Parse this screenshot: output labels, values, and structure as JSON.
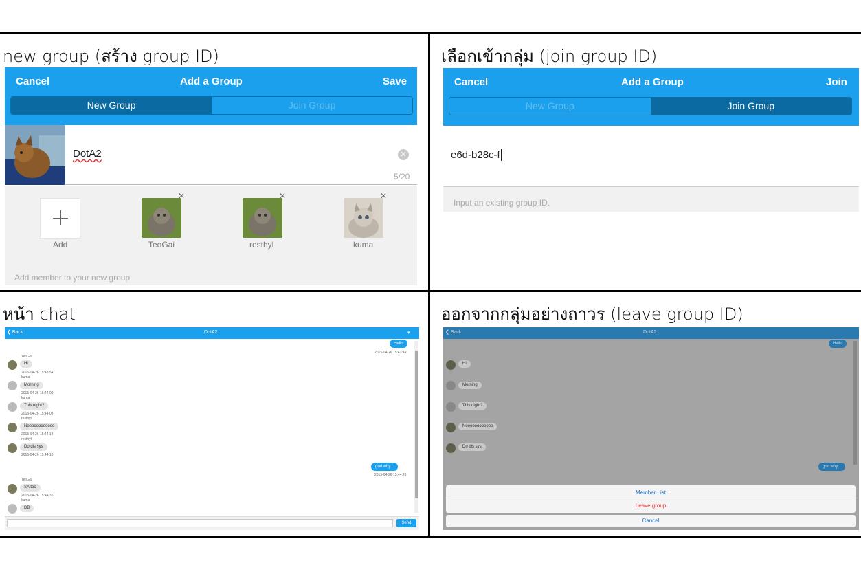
{
  "captions": {
    "new_group": "new group (สร้าง group ID)",
    "join_group": "เลือกเข้ากลุ่ม (join group ID)",
    "chat": "หน้า chat",
    "leave": "ออกจากกลุ่มอย่างถาวร (leave group ID)"
  },
  "panel_new": {
    "cancel": "Cancel",
    "title": "Add a Group",
    "save": "Save",
    "tab_new": "New Group",
    "tab_join": "Join Group",
    "group_name": "DotA2",
    "counter": "5/20",
    "add_label": "Add",
    "members": [
      {
        "name": "TeoGai"
      },
      {
        "name": "resthyl"
      },
      {
        "name": "kuma"
      }
    ],
    "hint": "Add member to your new group."
  },
  "panel_join": {
    "cancel": "Cancel",
    "title": "Add a Group",
    "join": "Join",
    "tab_new": "New Group",
    "tab_join": "Join Group",
    "group_id": "e6d-b28c-f",
    "hint": "Input an existing group ID."
  },
  "chat": {
    "back": "Back",
    "title": "DotA2",
    "send": "Send",
    "messages": [
      {
        "me": true,
        "text": "Hello",
        "time": "2015-04-26 15:43:49"
      },
      {
        "name": "TeoGai",
        "text": "Hi",
        "time": "2015-04-26 15:43:54"
      },
      {
        "name": "kuma",
        "text": "Morning",
        "time": "2015-04-26 15:44:00"
      },
      {
        "name": "kuma",
        "text": "This night?",
        "time": "2015-04-26 15:44:08"
      },
      {
        "name": "resthyl",
        "text": "Noooooooooooo",
        "time": "2015-04-26 15:44:14"
      },
      {
        "name": "resthyl",
        "text": "Do dis sys",
        "time": "2015-04-26 15:44:18"
      },
      {
        "me": true,
        "text": "god why...",
        "time": "2015-04-26 15:44:26"
      },
      {
        "name": "TeoGai",
        "text": "SA too",
        "time": "2015-04-26 15:44:35"
      },
      {
        "name": "kuma",
        "text": "DB",
        "time": ""
      }
    ]
  },
  "leave": {
    "back": "Back",
    "title": "DotA2",
    "member_list": "Member List",
    "leave_group": "Leave group",
    "cancel": "Cancel"
  },
  "colors": {
    "accent": "#1aa0ec",
    "dark": "#0b6aa2",
    "danger": "#e53935"
  }
}
